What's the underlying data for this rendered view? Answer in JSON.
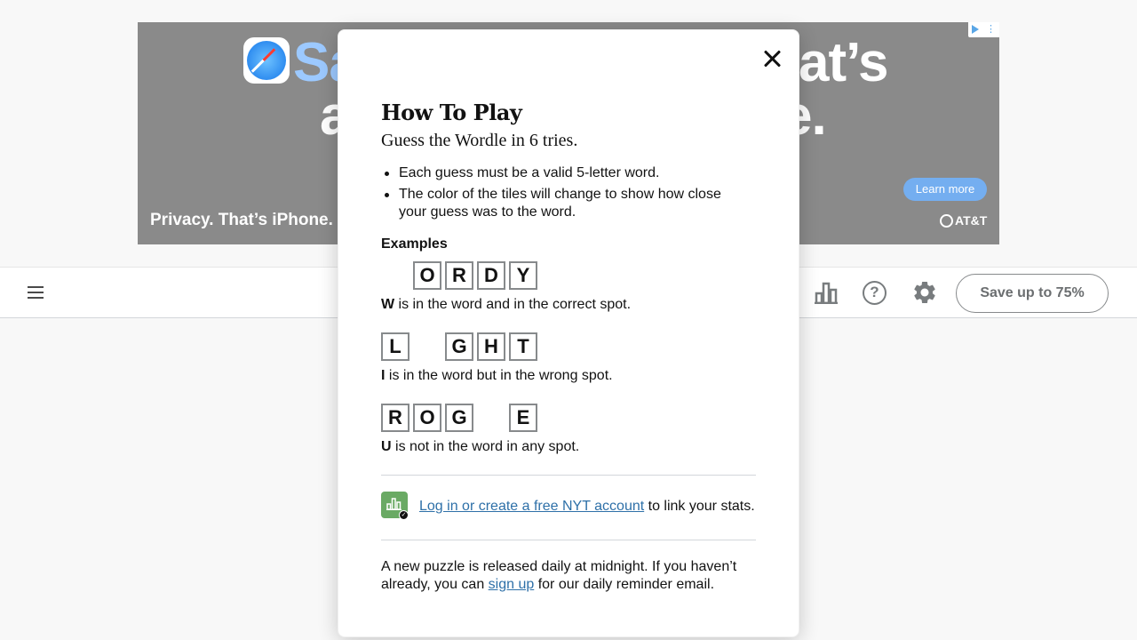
{
  "ad": {
    "headline_fragments": [
      "Sa",
      "at’s",
      "a",
      "e."
    ],
    "privacy_text": "Privacy. That’s iPhone.",
    "learn_more": "Learn more",
    "brand": "AT&T"
  },
  "header": {
    "save_button": "Save up to 75%",
    "help_glyph": "?"
  },
  "modal": {
    "title": "How To Play",
    "subtitle": "Guess the Wordle in 6 tries.",
    "rules": [
      "Each guess must be a valid 5-letter word.",
      "The color of the tiles will change to show how close your guess was to the word."
    ],
    "examples_label": "Examples",
    "examples": [
      {
        "tiles": [
          "",
          "O",
          "R",
          "D",
          "Y"
        ],
        "letter": "W",
        "description": " is in the word and in the correct spot."
      },
      {
        "tiles": [
          "L",
          "",
          "G",
          "H",
          "T"
        ],
        "letter": "I",
        "description": " is in the word but in the wrong spot."
      },
      {
        "tiles": [
          "R",
          "O",
          "G",
          "",
          "E"
        ],
        "letter": "U",
        "description": " is not in the word in any spot."
      }
    ],
    "login_link": "Log in or create a free NYT account",
    "login_suffix": " to link your stats.",
    "footer_prefix": "A new puzzle is released daily at midnight. If you haven’t already, you can ",
    "footer_link": "sign up",
    "footer_suffix": " for our daily reminder email."
  },
  "colors": {
    "accent_green": "#6aaa64",
    "link_blue": "#2e70a8",
    "tile_border": "#878a8c"
  },
  "icons": [
    "menu-icon",
    "stats-icon",
    "help-icon",
    "gear-icon",
    "close-icon",
    "safari-icon",
    "apple-icon",
    "att-globe-icon",
    "adchoices-icon"
  ]
}
